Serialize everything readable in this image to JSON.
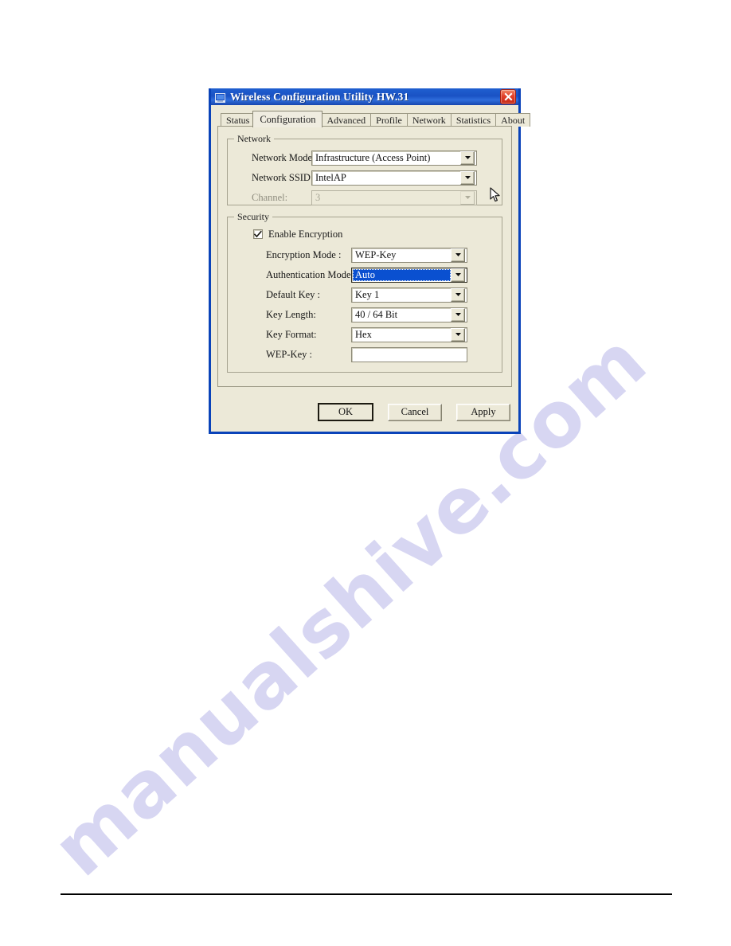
{
  "page": {
    "watermark_text": "manualshive.com"
  },
  "window": {
    "title": "Wireless Configuration Utility HW.31",
    "icon": "computer-icon",
    "close_label": "×"
  },
  "tabs": [
    {
      "label": "Status",
      "active": false
    },
    {
      "label": "Configuration",
      "active": true
    },
    {
      "label": "Advanced",
      "active": false
    },
    {
      "label": "Profile",
      "active": false
    },
    {
      "label": "Network",
      "active": false
    },
    {
      "label": "Statistics",
      "active": false
    },
    {
      "label": "About",
      "active": false
    }
  ],
  "network_group": {
    "legend": "Network",
    "network_mode": {
      "label": "Network Mode:",
      "value": "Infrastructure  (Access Point)"
    },
    "network_ssid": {
      "label": "Network SSID:",
      "value": "IntelAP"
    },
    "channel": {
      "label": "Channel:",
      "value": "3",
      "disabled": true
    }
  },
  "security_group": {
    "legend": "Security",
    "enable_encryption": {
      "label": "Enable Encryption",
      "checked": true
    },
    "encryption_mode": {
      "label": "Encryption Mode :",
      "value": "WEP-Key"
    },
    "authentication_mode": {
      "label": "Authentication Mode :",
      "value": "Auto",
      "selected": true
    },
    "default_key": {
      "label": "Default Key :",
      "value": "Key 1"
    },
    "key_length": {
      "label": "Key Length:",
      "value": "40 / 64 Bit"
    },
    "key_format": {
      "label": "Key Format:",
      "value": "Hex"
    },
    "wep_key": {
      "label": "WEP-Key :",
      "value": "",
      "placeholder": ""
    }
  },
  "buttons": {
    "ok": "OK",
    "cancel": "Cancel",
    "apply": "Apply"
  },
  "colors": {
    "titlebar_blue": "#1a52c4",
    "window_border": "#0a43b9",
    "dialog_face": "#ece9d8",
    "selection_blue": "#0a50d0",
    "close_red": "#c62a16",
    "watermark": "#d7d6f2"
  }
}
